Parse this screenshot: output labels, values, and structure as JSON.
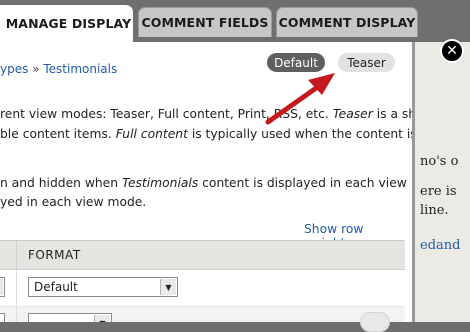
{
  "tabs": [
    {
      "label": "MANAGE DISPLAY"
    },
    {
      "label": "COMMENT FIELDS"
    },
    {
      "label": "COMMENT DISPLAY"
    }
  ],
  "breadcrumb": {
    "part1": "ypes",
    "separator": "»",
    "part2": "Testimonials"
  },
  "view_modes": {
    "default_label": "Default",
    "teaser_label": "Teaser"
  },
  "description": {
    "line1_a": "rent view modes: Teaser, Full content, Print, RSS, etc. ",
    "line1_em": "Teaser",
    "line1_b": " is a short",
    "line2_a": "ble content items. ",
    "line2_em": "Full content",
    "line2_b": " is typically used when the content is",
    "line3_a": "n and hidden when ",
    "line3_em": "Testimonials",
    "line3_b": " content is displayed in each view",
    "line4": "yed in each view mode."
  },
  "show_row_weights": "Show row weights",
  "table": {
    "header_format": "FORMAT",
    "rows": [
      {
        "format": "Default"
      }
    ]
  },
  "background_page": {
    "line1": "no's o",
    "line2": "ere is",
    "line3": "line.",
    "line4": "edand"
  },
  "close_icon": "close-icon",
  "colors": {
    "link": "#1f5ca8",
    "annotation_arrow": "#c4191f",
    "active_pill": "#5f5f5f"
  }
}
